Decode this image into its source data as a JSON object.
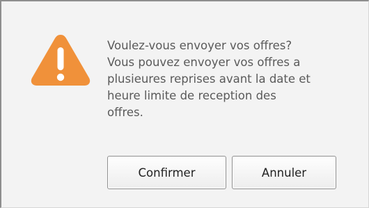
{
  "dialog": {
    "icon": "warning-icon",
    "accent_color": "#f0913a",
    "message_lines": [
      "Voulez-vous envoyer vos offres?",
      "Vous pouvez envoyer vos offres a",
      "plusieures reprises avant la date et",
      "heure limite de reception des",
      "offres."
    ],
    "buttons": {
      "confirm_label": "Confirmer",
      "cancel_label": "Annuler"
    }
  }
}
